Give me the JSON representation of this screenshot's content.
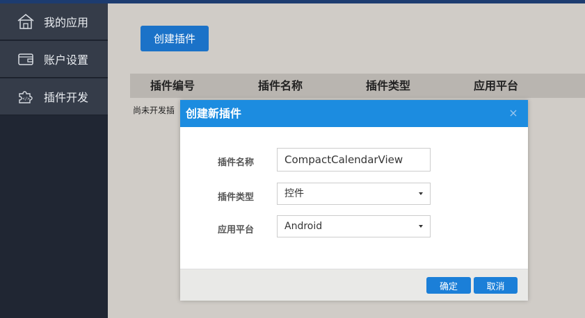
{
  "sidebar": {
    "items": [
      {
        "label": "我的应用",
        "icon": "home-icon"
      },
      {
        "label": "账户设置",
        "icon": "wallet-icon"
      },
      {
        "label": "插件开发",
        "icon": "plugin-icon"
      }
    ]
  },
  "main": {
    "create_button": "创建插件",
    "table_headers": [
      "插件编号",
      "插件名称",
      "插件类型",
      "应用平台"
    ],
    "empty_text": "尚未开发插"
  },
  "modal": {
    "title": "创建新插件",
    "close_icon": "close-icon",
    "fields": {
      "name_label": "插件名称",
      "name_value": "CompactCalendarView",
      "type_label": "插件类型",
      "type_value": "控件",
      "platform_label": "应用平台",
      "platform_value": "Android"
    },
    "ok_button": "确定",
    "cancel_button": "取消"
  },
  "colors": {
    "accent": "#1b72c8",
    "modal_header": "#1c8ce0",
    "sidebar": "#202633",
    "sidebar_item": "#353c49"
  }
}
